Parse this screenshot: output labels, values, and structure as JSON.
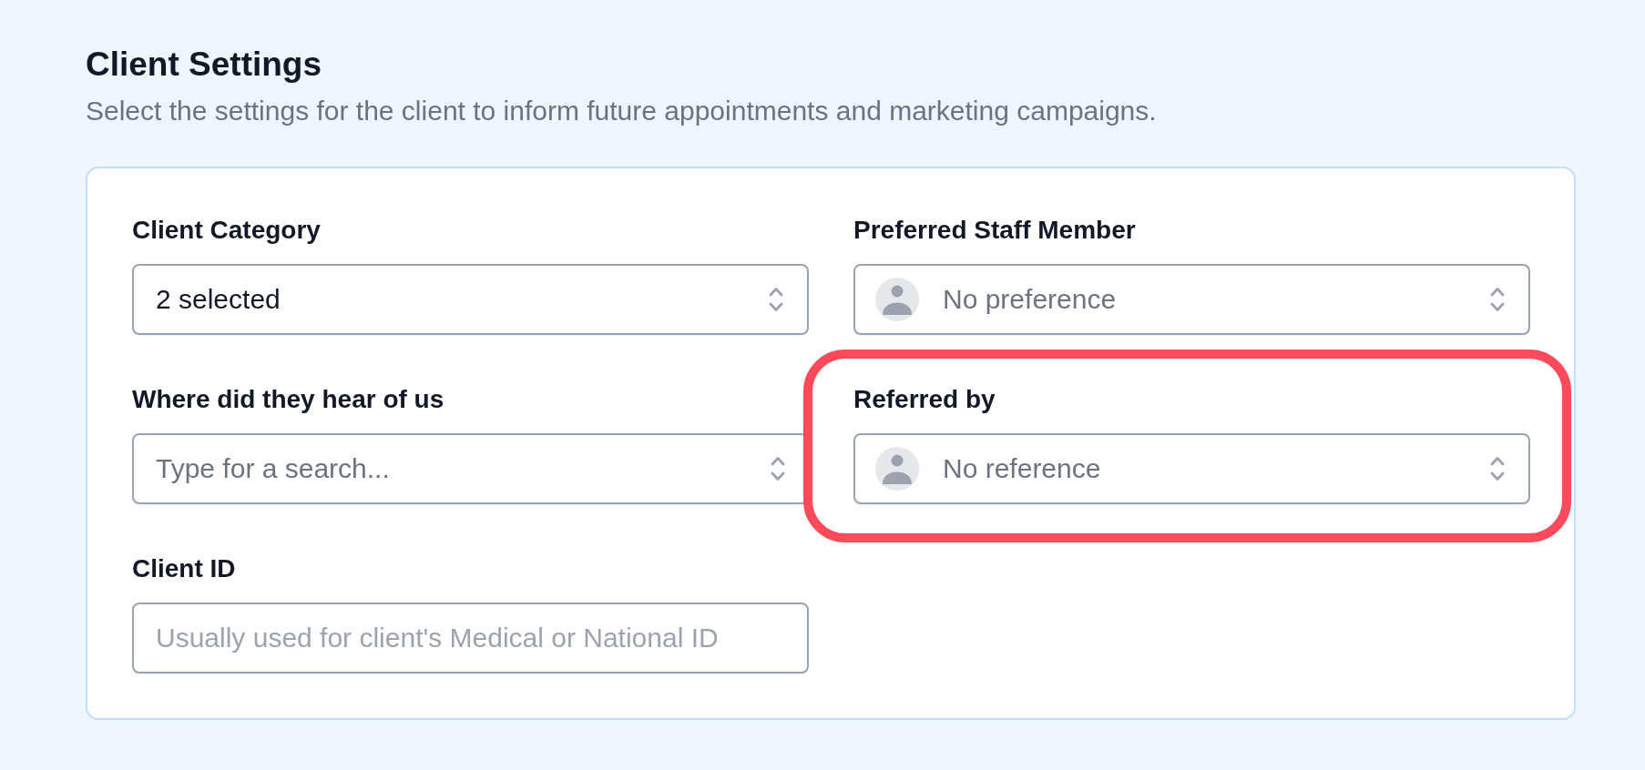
{
  "header": {
    "title": "Client Settings",
    "subtitle": "Select the settings for the client to inform future appointments and marketing campaigns."
  },
  "fields": [
    {
      "kind": "select",
      "label": "Client Category",
      "value": "2 selected",
      "highlighted": false
    },
    {
      "kind": "person-select",
      "label": "Preferred Staff Member",
      "placeholder": "No preference",
      "highlighted": false
    },
    {
      "kind": "combobox",
      "label": "Where did they hear of us",
      "placeholder": "Type for a search...",
      "highlighted": false
    },
    {
      "kind": "person-select",
      "label": "Referred by",
      "placeholder": "No reference",
      "highlighted": true
    },
    {
      "kind": "text",
      "label": "Client ID",
      "placeholder": "Usually used for client's Medical or National ID",
      "highlighted": false
    }
  ]
}
